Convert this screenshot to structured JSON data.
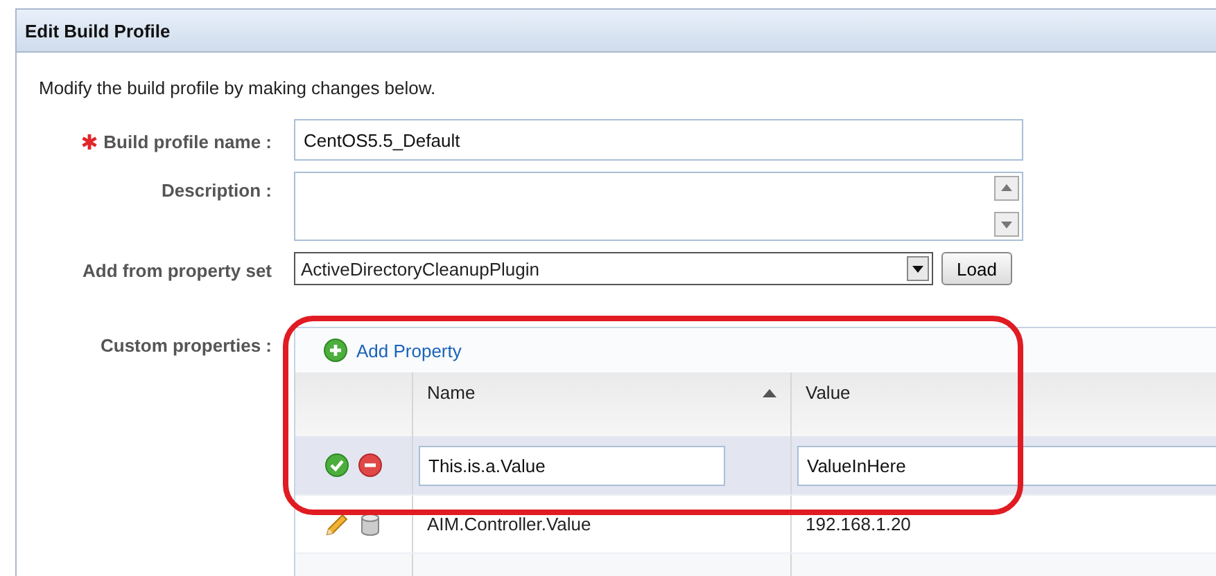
{
  "panel": {
    "title": "Edit Build Profile"
  },
  "intro": "Modify the build profile by making changes below.",
  "build_profile_name": {
    "label": "Build profile name :",
    "required": true,
    "value": "CentOS5.5_Default"
  },
  "description": {
    "label": "Description :"
  },
  "property_set": {
    "label": "Add from property set",
    "value": "ActiveDirectoryCleanupPlugin",
    "button": "Load"
  },
  "custom_properties": {
    "label": "Custom properties :",
    "add_link": "Add Property",
    "columns": [
      {
        "label": "Name",
        "sorted": true
      },
      {
        "label": "Value",
        "sorted": false
      }
    ],
    "edit_row": {
      "name": "This.is.a.Value",
      "value": "ValueInHere"
    },
    "rows": [
      {
        "name": "AIM.Controller.Value",
        "value": "192.168.1.20"
      }
    ]
  },
  "highlight": {
    "shown": true
  }
}
